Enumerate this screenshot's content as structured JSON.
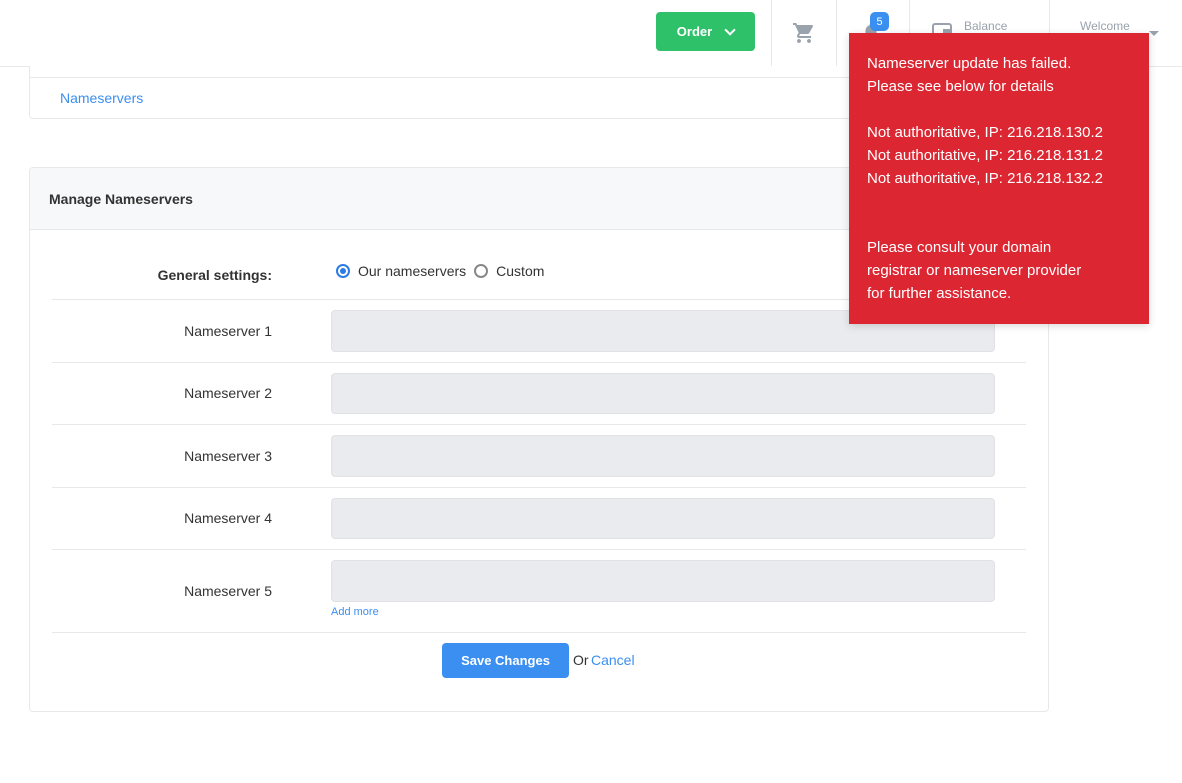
{
  "header": {
    "order_label": "Order",
    "notification_count": "5",
    "balance_label": "Balance",
    "welcome_label": "Welcome"
  },
  "top_card": {
    "nameservers_link": "Nameservers"
  },
  "manage": {
    "title": "Manage Nameservers",
    "general_settings_label": "General settings:",
    "radio_options": [
      {
        "label": "Our nameservers",
        "checked": true
      },
      {
        "label": "Custom",
        "checked": false
      }
    ],
    "nameservers": [
      {
        "label": "Nameserver 1",
        "value": ""
      },
      {
        "label": "Nameserver 2",
        "value": ""
      },
      {
        "label": "Nameserver 3",
        "value": ""
      },
      {
        "label": "Nameserver 4",
        "value": ""
      },
      {
        "label": "Nameserver 5",
        "value": ""
      }
    ],
    "add_more": "Add more",
    "save_label": "Save Changes",
    "or_text": "Or",
    "cancel_label": "Cancel"
  },
  "toast": {
    "line1": "Nameserver update has failed.",
    "line2": "Please see below for details",
    "errors": [
      "Not authoritative, IP: 216.218.130.2",
      "Not authoritative, IP: 216.218.131.2",
      "Not authoritative, IP: 216.218.132.2"
    ],
    "footer1": "Please consult your domain",
    "footer2": "registrar or nameserver provider",
    "footer3": "for further assistance."
  },
  "colors": {
    "order_green": "#2fc16a",
    "accent_blue": "#3b8ff0",
    "error_red": "#dc2632"
  }
}
